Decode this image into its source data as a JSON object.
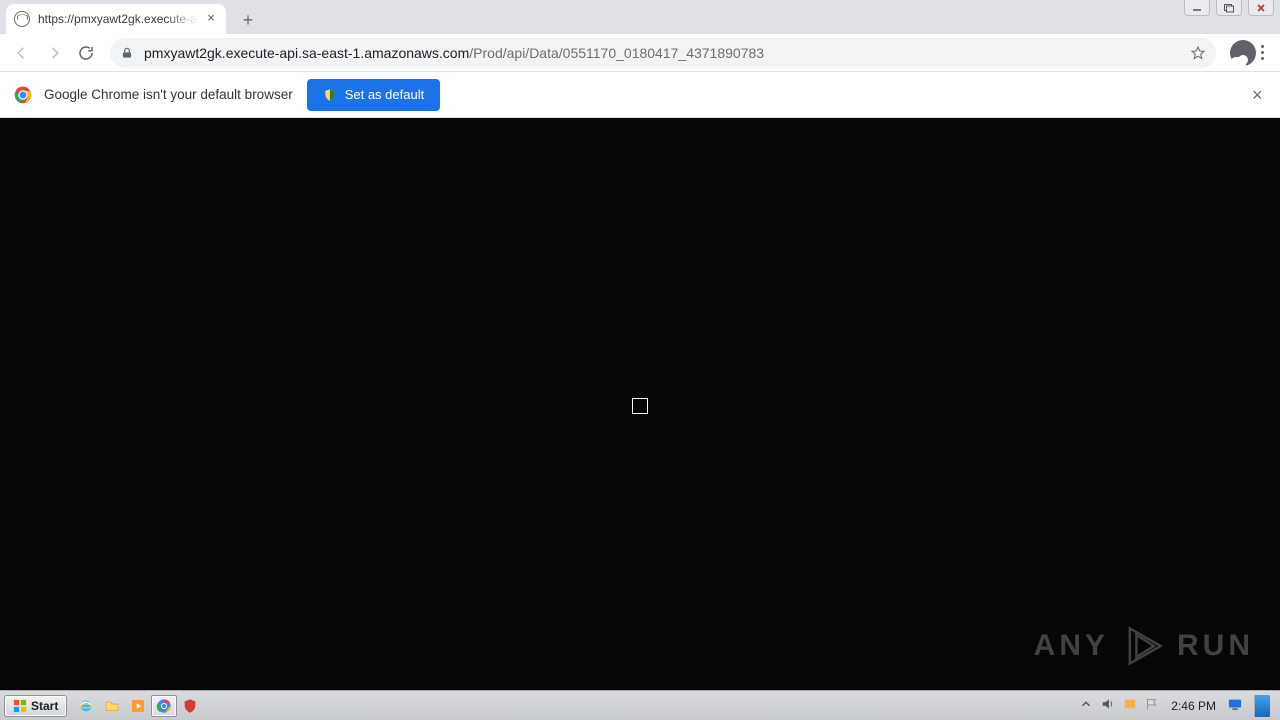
{
  "window": {
    "tab_title": "https://pmxyawt2gk.execute-api.sa…"
  },
  "address_bar": {
    "domain": "pmxyawt2gk.execute-api.sa-east-1.amazonaws.com",
    "path": "/Prod/api/Data/0551170_0180417_4371890783"
  },
  "infobar": {
    "message": "Google Chrome isn't your default browser",
    "button_label": "Set as default"
  },
  "watermark": {
    "left": "ANY",
    "right": "RUN"
  },
  "taskbar": {
    "start_label": "Start",
    "clock": "2:46 PM"
  }
}
